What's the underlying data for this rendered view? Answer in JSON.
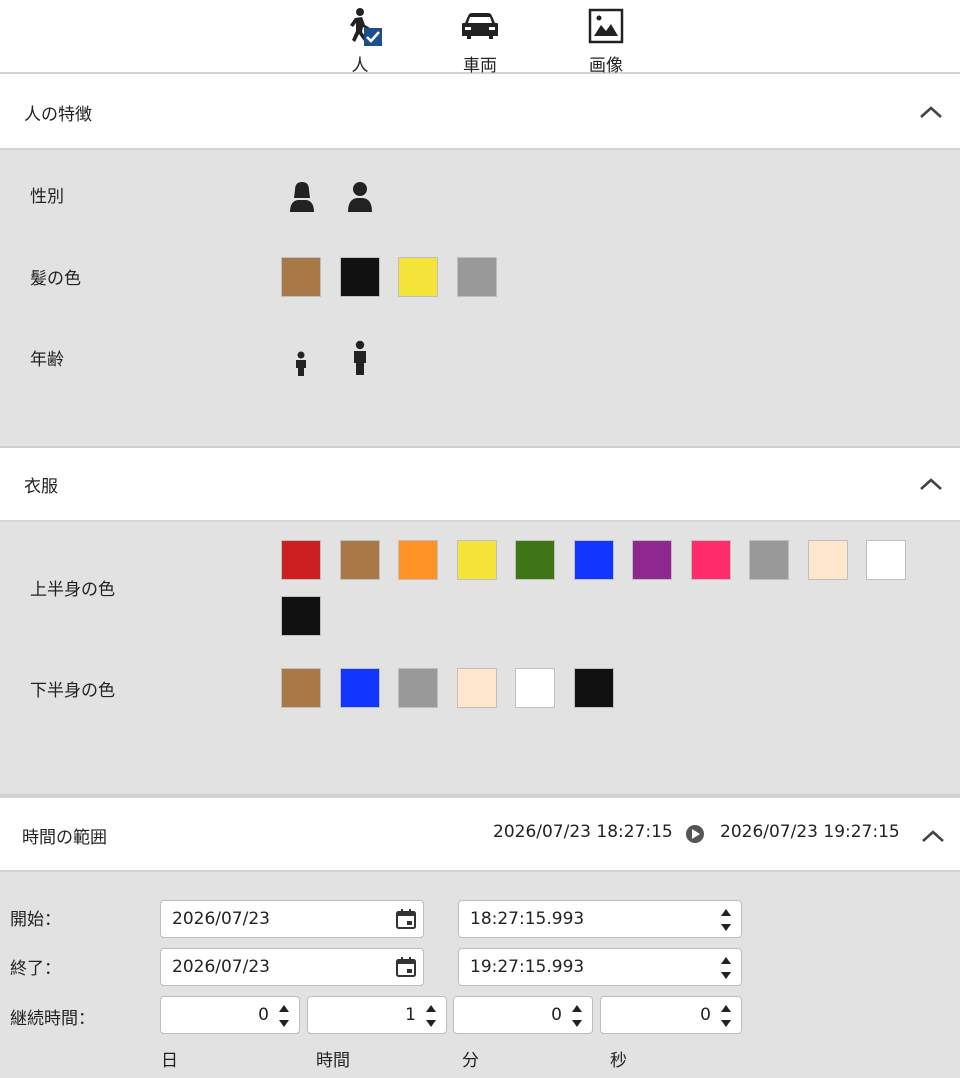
{
  "tabs": [
    {
      "label": "人",
      "icon": "running-person-check-icon",
      "selected": true
    },
    {
      "label": "車両",
      "icon": "car-icon"
    },
    {
      "label": "画像",
      "icon": "image-icon"
    }
  ],
  "person_features": {
    "title": "人の特徴",
    "gender_label": "性別",
    "hair_label": "髪の色",
    "age_label": "年齢",
    "gender_icons": [
      "female-icon",
      "male-icon"
    ],
    "age_icons": [
      "child-icon",
      "adult-icon"
    ],
    "hair_colors": [
      "#a87847",
      "#111111",
      "#f5e43a",
      "#999999"
    ]
  },
  "clothing": {
    "title": "衣服",
    "upper_label": "上半身の色",
    "lower_label": "下半身の色",
    "upper_colors": [
      "#cc1f1f",
      "#a87847",
      "#ff9226",
      "#f5e43a",
      "#3f7517",
      "#1336ff",
      "#8f2790",
      "#ff2c6b",
      "#999999",
      "#ffe6cc",
      "#ffffff",
      "#111111"
    ],
    "lower_colors": [
      "#a87847",
      "#1336ff",
      "#999999",
      "#ffe6cc",
      "#ffffff",
      "#111111"
    ]
  },
  "time_range": {
    "title": "時間の範囲",
    "range_start": "2026/07/23 18:27:15",
    "range_end": "2026/07/23 19:27:15",
    "start_label": "開始：",
    "end_label": "終了：",
    "duration_label": "継続時間：",
    "start_date": "2026/07/23",
    "start_time": "18:27:15.993",
    "end_date": "2026/07/23",
    "end_time": "19:27:15.993",
    "duration": {
      "days": "0",
      "hours": "1",
      "minutes": "0",
      "seconds": "0"
    },
    "units": {
      "days": "日",
      "hours": "時間",
      "minutes": "分",
      "seconds": "秒"
    }
  }
}
